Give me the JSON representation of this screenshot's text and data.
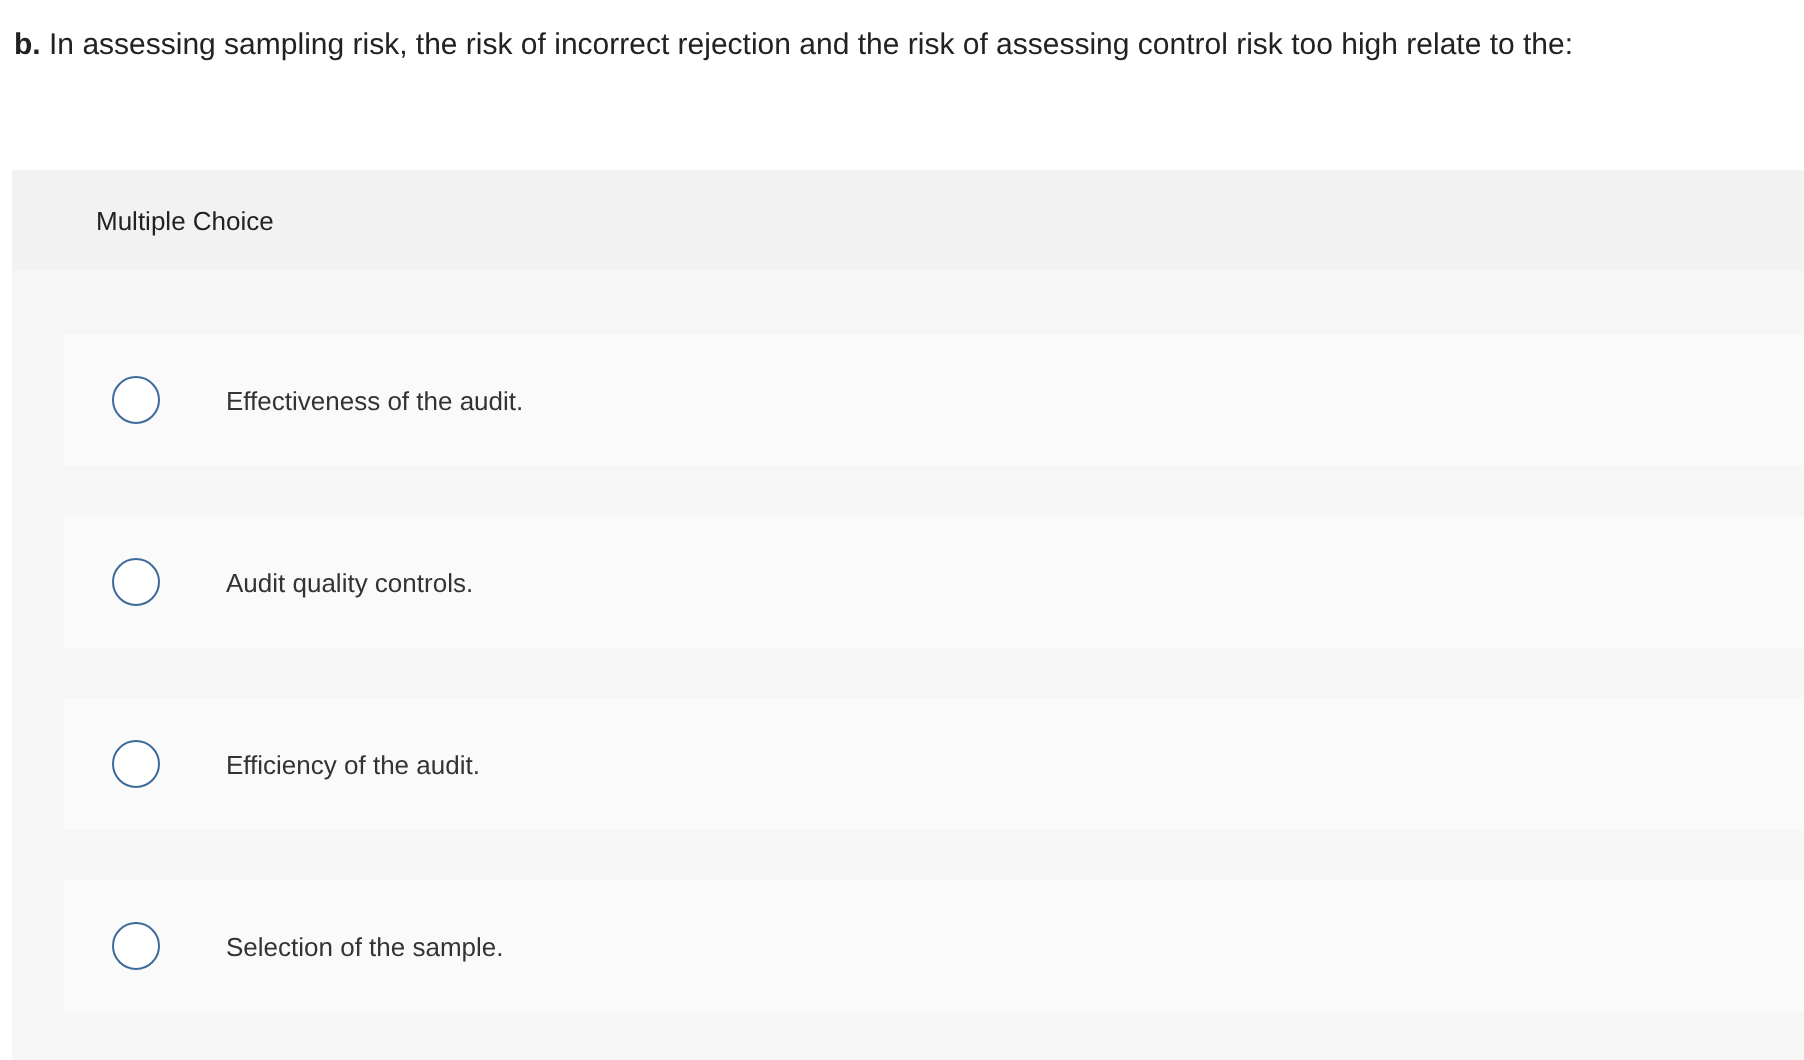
{
  "question": "**b.** In assessing sampling risk, the risk of incorrect rejection and the risk of assessing control risk too high relate to the:",
  "panel": {
    "header": "Multiple Choice",
    "options": [
      {
        "label": "Effectiveness of the audit.",
        "selected": false
      },
      {
        "label": "Audit quality controls.",
        "selected": false
      },
      {
        "label": "Efficiency of the audit.",
        "selected": false
      },
      {
        "label": "Selection of the sample.",
        "selected": false
      }
    ]
  }
}
